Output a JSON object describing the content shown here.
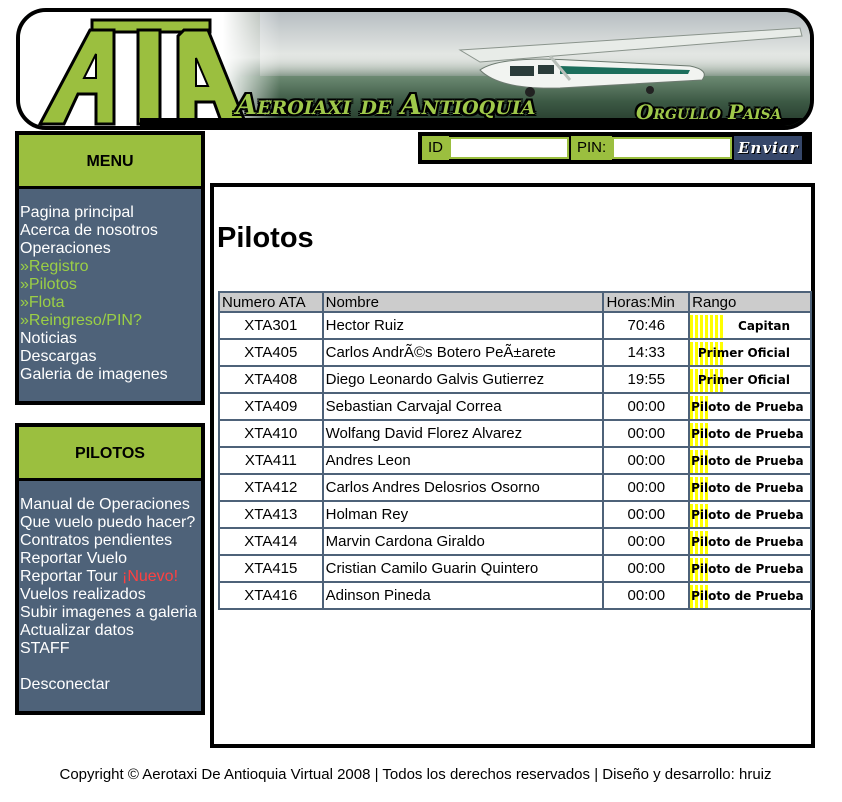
{
  "banner": {
    "logo_text": "ATA",
    "title": "Aeroiaxi de Antioquia",
    "slogan": "Orgullo Paisa"
  },
  "login": {
    "id_label": "ID",
    "id_value": "",
    "pin_label": "PIN:",
    "pin_value": "",
    "send_label": "Enviar"
  },
  "menu": {
    "title": "MENU",
    "items": [
      {
        "label": "Pagina principal",
        "sub": false
      },
      {
        "label": "Acerca de nosotros",
        "sub": false
      },
      {
        "label": "Operaciones",
        "sub": false
      },
      {
        "label": "»Registro",
        "sub": true
      },
      {
        "label": "»Pilotos",
        "sub": true
      },
      {
        "label": "»Flota",
        "sub": true
      },
      {
        "label": "»Reingreso/PIN?",
        "sub": true
      },
      {
        "label": "Noticias",
        "sub": false
      },
      {
        "label": "Descargas",
        "sub": false
      },
      {
        "label": "Galeria de imagenes",
        "sub": false
      }
    ]
  },
  "pilots_menu": {
    "title": "PILOTOS",
    "items": [
      {
        "label": "Manual de Operaciones"
      },
      {
        "label": "Que vuelo puedo hacer?"
      },
      {
        "label": "Contratos pendientes"
      },
      {
        "label": "Reportar Vuelo"
      },
      {
        "label": "Reportar Tour",
        "badge": "¡Nuevo!"
      },
      {
        "label": "Vuelos realizados"
      },
      {
        "label": "Subir imagenes a galeria"
      },
      {
        "label": "Actualizar datos"
      },
      {
        "label": "STAFF"
      }
    ],
    "disconnect": "Desconectar"
  },
  "main": {
    "title": "Pilotos",
    "columns": [
      "Numero ATA",
      "Nombre",
      "Horas:Min",
      "Rango"
    ],
    "rows": [
      {
        "id": "XTA301",
        "name": "Hector Ruiz",
        "hours": "70:46",
        "rank": "Capitan",
        "rank_class": "capitan"
      },
      {
        "id": "XTA405",
        "name": "Carlos AndrÃ©s Botero PeÃ±arete",
        "hours": "14:33",
        "rank": "Primer Oficial",
        "rank_class": "primer"
      },
      {
        "id": "XTA408",
        "name": "Diego Leonardo Galvis Gutierrez",
        "hours": "19:55",
        "rank": "Primer Oficial",
        "rank_class": "primer"
      },
      {
        "id": "XTA409",
        "name": "Sebastian Carvajal Correa",
        "hours": "00:00",
        "rank": "Piloto de Prueba",
        "rank_class": "prueba"
      },
      {
        "id": "XTA410",
        "name": "Wolfang David Florez Alvarez",
        "hours": "00:00",
        "rank": "Piloto de Prueba",
        "rank_class": "prueba"
      },
      {
        "id": "XTA411",
        "name": "Andres Leon",
        "hours": "00:00",
        "rank": "Piloto de Prueba",
        "rank_class": "prueba"
      },
      {
        "id": "XTA412",
        "name": "Carlos Andres Delosrios Osorno",
        "hours": "00:00",
        "rank": "Piloto de Prueba",
        "rank_class": "prueba"
      },
      {
        "id": "XTA413",
        "name": "Holman Rey",
        "hours": "00:00",
        "rank": "Piloto de Prueba",
        "rank_class": "prueba"
      },
      {
        "id": "XTA414",
        "name": "Marvin Cardona Giraldo",
        "hours": "00:00",
        "rank": "Piloto de Prueba",
        "rank_class": "prueba"
      },
      {
        "id": "XTA415",
        "name": "Cristian Camilo Guarin Quintero",
        "hours": "00:00",
        "rank": "Piloto de Prueba",
        "rank_class": "prueba"
      },
      {
        "id": "XTA416",
        "name": "Adinson Pineda",
        "hours": "00:00",
        "rank": "Piloto de Prueba",
        "rank_class": "prueba"
      }
    ]
  },
  "footer": {
    "text": "Copyright © Aerotaxi De Antioquia Virtual 2008 | Todos los derechos reservados | Diseño y desarrollo: hruiz"
  },
  "colors": {
    "accent_green": "#9bbf3f",
    "sidebar_blue": "#4e6279",
    "submenu_green": "#9bcf45",
    "new_badge_red": "#ff4040",
    "rank_yellow": "#ffff00"
  },
  "icons": {
    "logo": "ata-logo",
    "banner_image": "airplane-banner"
  }
}
